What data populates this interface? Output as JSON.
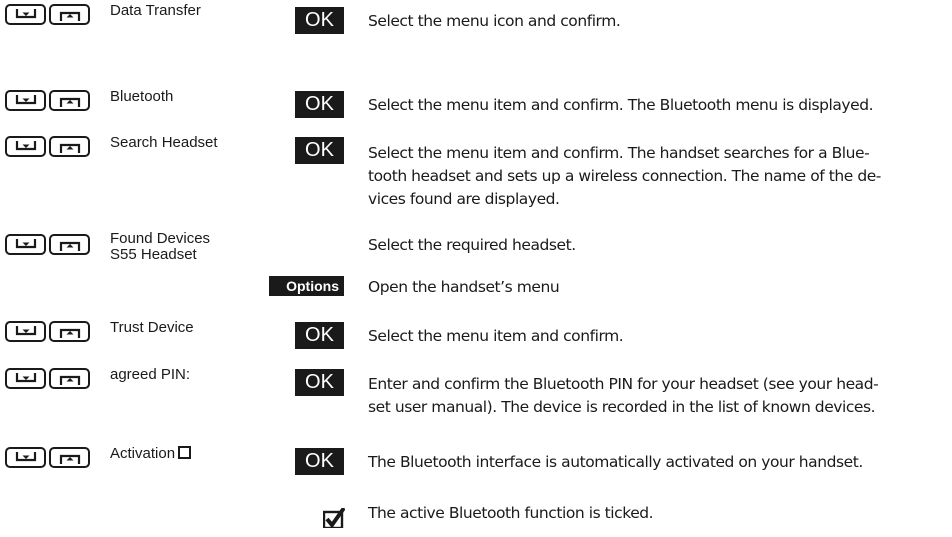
{
  "steps": [
    {
      "display": "Data Transfer",
      "confirm": "OK",
      "description": [
        "Select the menu icon and confirm."
      ]
    },
    {
      "display": "Bluetooth",
      "confirm": "OK",
      "description": [
        "Select the menu item and confirm. The Bluetooth menu is displayed."
      ]
    },
    {
      "display": "Search Headset",
      "confirm": "OK",
      "description": [
        "Select the menu item and confirm. The handset searches for a Blue-",
        "tooth headset and sets up a wireless connection. The name of the de-",
        "vices found are displayed."
      ]
    },
    {
      "display": [
        "Found Devices",
        "S55 Headset"
      ],
      "description": [
        "Select the required headset."
      ]
    },
    {
      "softkey": "Options",
      "description": [
        "Open the handset’s menu"
      ]
    },
    {
      "display": "Trust Device",
      "confirm": "OK",
      "description": [
        "Select the menu item and confirm."
      ]
    },
    {
      "display": "agreed PIN:",
      "confirm": "OK",
      "description": [
        "Enter and confirm the Bluetooth PIN for your headset (see your head-",
        "set user manual). The device is recorded in the list of known devices."
      ]
    },
    {
      "display": "Activation",
      "confirm": "OK",
      "description": [
        "The Bluetooth interface is automatically activated on your handset."
      ]
    },
    {
      "icon": "checkmark-icon",
      "description": [
        "The active Bluetooth function is ticked."
      ]
    }
  ],
  "icons": {
    "nav_down": "arrow-down-key-icon",
    "nav_up": "arrow-up-key-icon",
    "checkbox": "empty-checkbox-icon",
    "tick": "checkmark-icon"
  },
  "colors": {
    "ink": "#1a1a1a",
    "paper": "#ffffff"
  }
}
